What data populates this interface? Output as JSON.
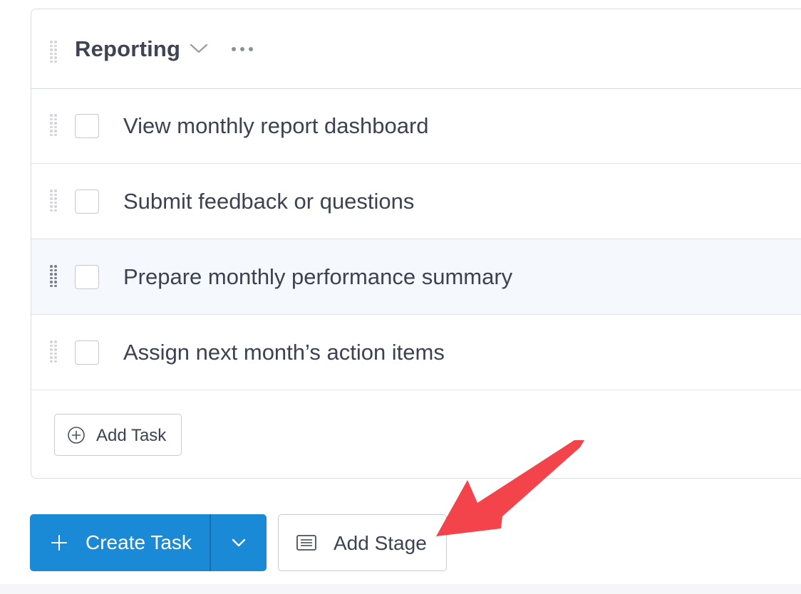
{
  "stage": {
    "title": "Reporting",
    "chevron_icon": "chevron-down-icon",
    "more_icon": "more-horizontal-icon",
    "drag_icon": "drag-handle-icon"
  },
  "tasks": [
    {
      "label": "View monthly report dashboard",
      "checked": false
    },
    {
      "label": "Submit feedback or questions",
      "checked": false
    },
    {
      "label": "Prepare monthly performance summary",
      "checked": false,
      "hovered": true
    },
    {
      "label": "Assign next month’s action items",
      "checked": false
    }
  ],
  "add_task": {
    "label": "Add Task",
    "icon": "plus-circle-icon"
  },
  "create_task": {
    "label": "Create Task",
    "icon": "plus-icon",
    "dropdown_icon": "chevron-down-icon"
  },
  "add_stage": {
    "label": "Add Stage",
    "icon": "list-icon"
  },
  "colors": {
    "primary": "#1b8ad6",
    "annotation_arrow": "#f2444a",
    "row_hover": "#f5f9fd",
    "text": "#3d4250"
  }
}
